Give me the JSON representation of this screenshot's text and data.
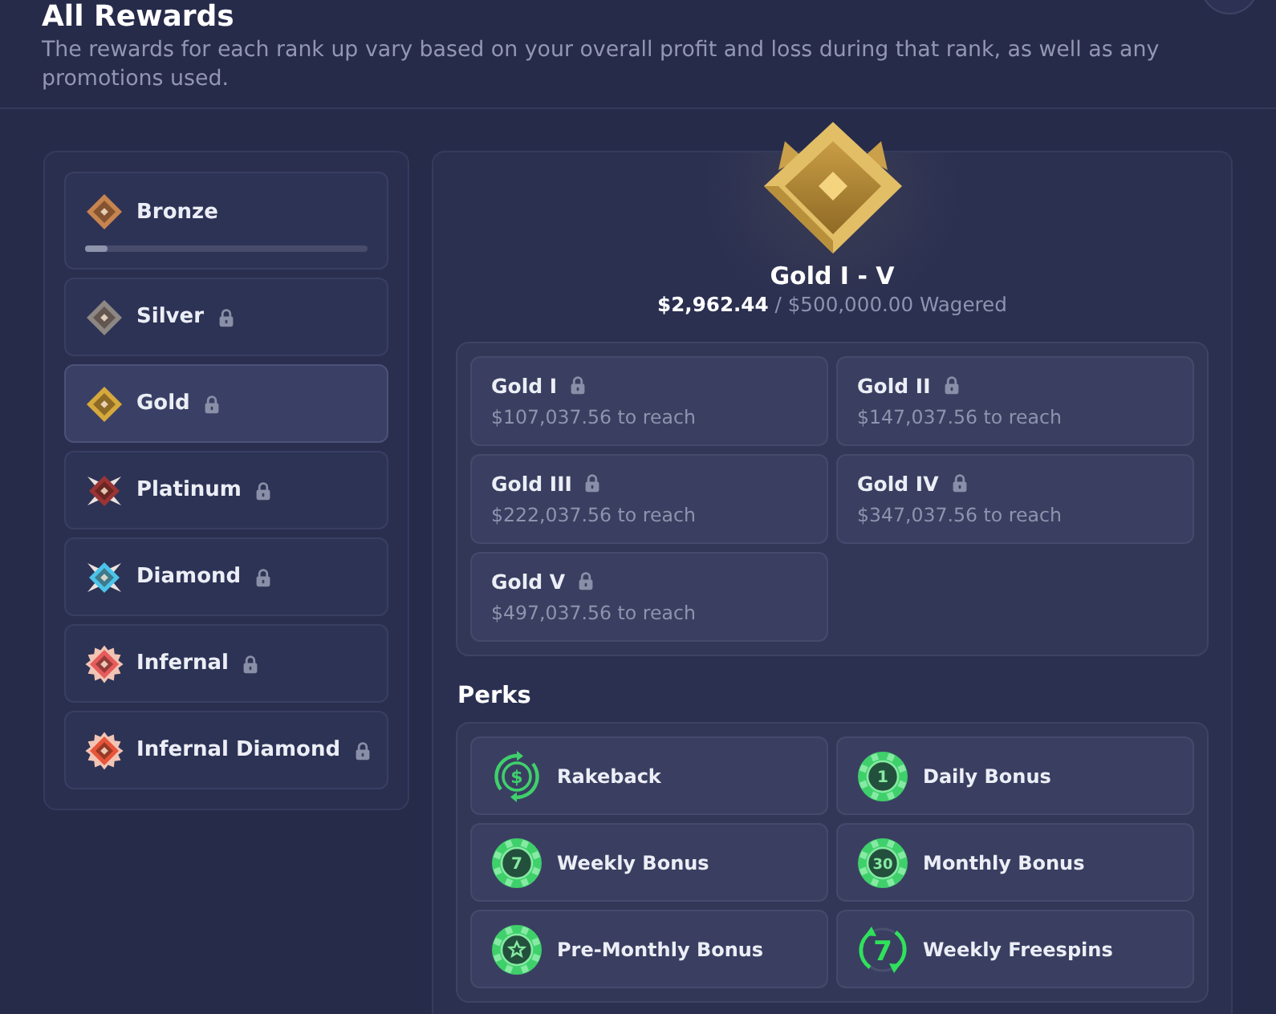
{
  "header": {
    "title": "All Rewards",
    "description": "The rewards for each rank up vary based on your overall profit and loss during that rank, as well as any promotions used."
  },
  "ranks": [
    {
      "name": "Bronze",
      "kind": "plain",
      "color": "#c7844f",
      "locked": false,
      "selected": false,
      "level": 0.08
    },
    {
      "name": "Silver",
      "kind": "plain",
      "color": "#8d8784",
      "locked": true,
      "selected": false
    },
    {
      "name": "Gold",
      "kind": "plain",
      "color": "#d6a93c",
      "locked": true,
      "selected": true
    },
    {
      "name": "Platinum",
      "kind": "winged",
      "color": "#9b3434",
      "locked": true,
      "selected": false
    },
    {
      "name": "Diamond",
      "kind": "winged",
      "color": "#4cc4ea",
      "locked": true,
      "selected": false
    },
    {
      "name": "Infernal",
      "kind": "spiked",
      "color": "#e65b5b",
      "locked": true,
      "selected": false
    },
    {
      "name": "Infernal Diamond",
      "kind": "spiked",
      "color": "#e8553a",
      "locked": true,
      "selected": false
    }
  ],
  "detail": {
    "title": "Gold I - V",
    "wagered": "$2,962.44",
    "target": "/ $500,000.00 Wagered",
    "tiers": [
      {
        "name": "Gold I",
        "locked": true,
        "requirement": "$107,037.56 to reach"
      },
      {
        "name": "Gold II",
        "locked": true,
        "requirement": "$147,037.56 to reach"
      },
      {
        "name": "Gold III",
        "locked": true,
        "requirement": "$222,037.56 to reach"
      },
      {
        "name": "Gold IV",
        "locked": true,
        "requirement": "$347,037.56 to reach"
      },
      {
        "name": "Gold V",
        "locked": true,
        "requirement": "$497,037.56 to reach"
      }
    ]
  },
  "perks": {
    "heading": "Perks",
    "items": [
      {
        "label": "Rakeback",
        "icon": {
          "kind": "rakeback",
          "label": "$"
        }
      },
      {
        "label": "Daily Bonus",
        "icon": {
          "kind": "chip",
          "label": "1"
        }
      },
      {
        "label": "Weekly Bonus",
        "icon": {
          "kind": "chip",
          "label": "7"
        }
      },
      {
        "label": "Monthly Bonus",
        "icon": {
          "kind": "chip",
          "label": "30"
        }
      },
      {
        "label": "Pre-Monthly Bonus",
        "icon": {
          "kind": "chip-star"
        }
      },
      {
        "label": "Weekly Freespins",
        "icon": {
          "kind": "freespins",
          "label": "7"
        }
      }
    ]
  }
}
